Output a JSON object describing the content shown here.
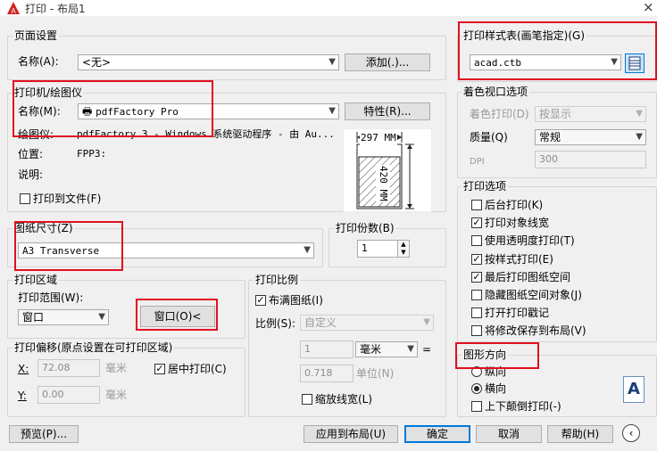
{
  "window": {
    "title": "打印 - 布局1",
    "close": "×"
  },
  "page_setup": {
    "group": "页面设置",
    "name_label": "名称(A):",
    "name_value": "<无>",
    "add_button": "添加(.)..."
  },
  "printer": {
    "group": "打印机/绘图仪",
    "name_label": "名称(M):",
    "name_value": "pdfFactory Pro",
    "properties_button": "特性(R)...",
    "plotter_label": "绘图仪:",
    "plotter_value": "pdfFactory 3 - Windows 系统驱动程序 - 由 Au...",
    "location_label": "位置:",
    "location_value": "FPP3:",
    "description_label": "说明:",
    "print_to_file": "打印到文件(F)",
    "preview_width": "297 MM",
    "preview_height": "420 MM"
  },
  "paper_size": {
    "group": "图纸尺寸(Z)",
    "value": "A3 Transverse"
  },
  "copies": {
    "group": "打印份数(B)",
    "value": "1"
  },
  "plot_area": {
    "group": "打印区域",
    "range_label": "打印范围(W):",
    "range_value": "窗口",
    "window_button": "窗口(O)<"
  },
  "plot_offset": {
    "group": "打印偏移(原点设置在可打印区域)",
    "x_label": "X:",
    "x_value": "72.08",
    "x_unit": "毫米",
    "y_label": "Y:",
    "y_value": "0.00",
    "y_unit": "毫米",
    "center": "居中打印(C)"
  },
  "plot_scale": {
    "group": "打印比例",
    "fit": "布满图纸(I)",
    "scale_label": "比例(S):",
    "scale_value": "自定义",
    "value1": "1",
    "unit": "毫米",
    "equals": "=",
    "value2": "0.718",
    "unit2": "单位(N)",
    "scale_lineweights": "缩放线宽(L)"
  },
  "plot_style_table": {
    "group": "打印样式表(画笔指定)(G)",
    "value": "acad.ctb"
  },
  "shaded_viewport": {
    "group": "着色视口选项",
    "shaded_label": "着色打印(D)",
    "shaded_value": "按显示",
    "quality_label": "质量(Q)",
    "quality_value": "常规",
    "dpi_label": "DPI",
    "dpi_value": "300"
  },
  "plot_options": {
    "group": "打印选项",
    "items": [
      {
        "label": "后台打印(K)",
        "checked": false
      },
      {
        "label": "打印对象线宽",
        "checked": true
      },
      {
        "label": "使用透明度打印(T)",
        "checked": false
      },
      {
        "label": "按样式打印(E)",
        "checked": true
      },
      {
        "label": "最后打印图纸空间",
        "checked": true
      },
      {
        "label": "隐藏图纸空间对象(J)",
        "checked": false
      },
      {
        "label": "打开打印戳记",
        "checked": false
      },
      {
        "label": "将修改保存到布局(V)",
        "checked": false
      }
    ]
  },
  "orientation": {
    "group": "图形方向",
    "portrait": "纵向",
    "landscape": "横向",
    "upside_down": "上下颠倒打印(-)",
    "badge": "A"
  },
  "footer": {
    "preview": "预览(P)...",
    "apply": "应用到布局(U)",
    "ok": "确定",
    "cancel": "取消",
    "help": "帮助(H)"
  },
  "colors": {
    "highlight": "#e01020",
    "default_button": "#0078d7"
  }
}
